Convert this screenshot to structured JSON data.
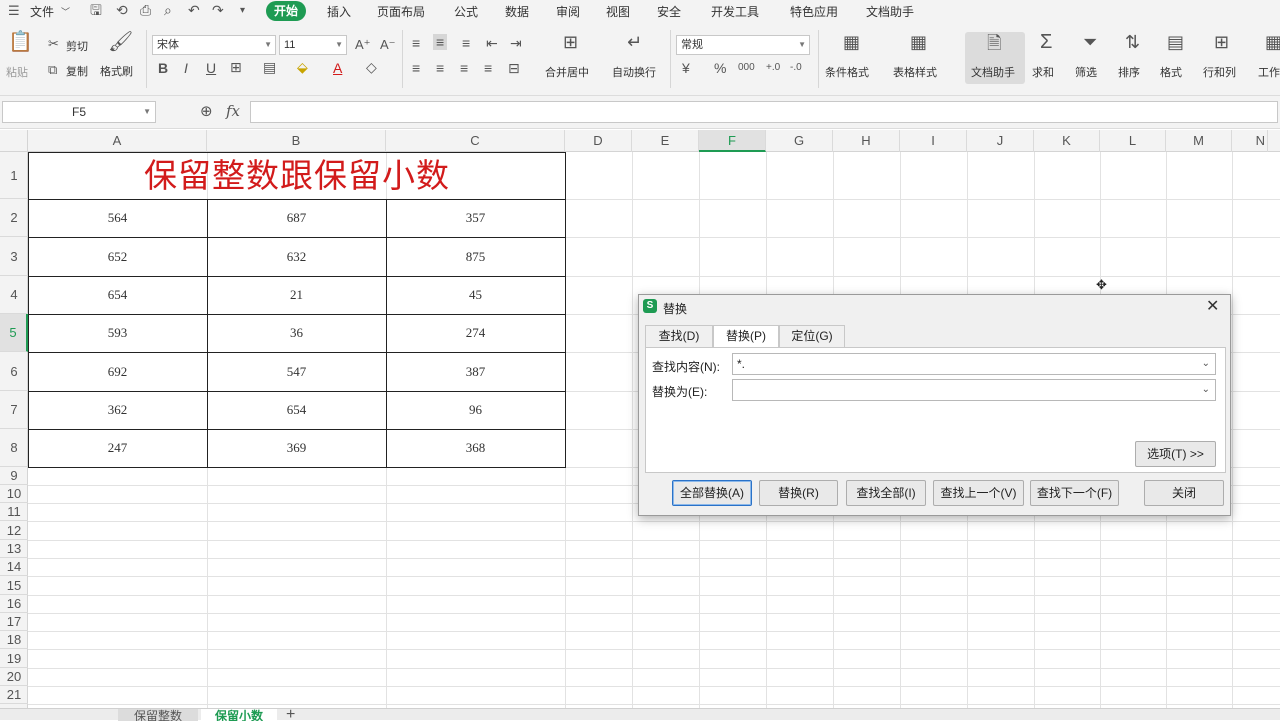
{
  "menubar": {
    "items": [
      "文件",
      "开始",
      "插入",
      "页面布局",
      "公式",
      "数据",
      "审阅",
      "视图",
      "安全",
      "开发工具",
      "特色应用",
      "文档助手"
    ],
    "active": "开始",
    "active_color": "#1e9b53"
  },
  "ribbon": {
    "paste": "粘贴",
    "cut": "剪切",
    "copy": "复制",
    "format_painter": "格式刷",
    "font_name": "宋体",
    "font_size": "11",
    "bold": "B",
    "italic": "I",
    "underline": "U",
    "font_color": "A",
    "merge_center": "合并居中",
    "wrap_text": "自动换行",
    "number_format": "常规",
    "percent": "%",
    "thousands": "000",
    "cond_format": "条件格式",
    "table_style": "表格样式",
    "doc_assistant": "文档助手",
    "sum": "求和",
    "filter": "筛选",
    "sort": "排序",
    "format": "格式",
    "row_col": "行和列",
    "worksheet": "工作"
  },
  "formula_bar": {
    "name_box": "F5",
    "fx": "fx",
    "content": ""
  },
  "columns": [
    "A",
    "B",
    "C",
    "D",
    "E",
    "F",
    "G",
    "H",
    "I",
    "J",
    "K",
    "L",
    "M",
    "N"
  ],
  "rows": [
    "1",
    "2",
    "3",
    "4",
    "5",
    "6",
    "7",
    "8",
    "9",
    "10",
    "11",
    "12",
    "13",
    "14",
    "15",
    "16",
    "17",
    "18",
    "19",
    "20",
    "21"
  ],
  "sheet": {
    "title": "保留整数跟保留小数",
    "title_color": "#d21b1b",
    "data": [
      [
        "564",
        "687",
        "357"
      ],
      [
        "652",
        "632",
        "875"
      ],
      [
        "654",
        "21",
        "45"
      ],
      [
        "593",
        "36",
        "274"
      ],
      [
        "692",
        "547",
        "387"
      ],
      [
        "362",
        "654",
        "96"
      ],
      [
        "247",
        "369",
        "368"
      ]
    ]
  },
  "sheet_tabs": [
    "保留整数",
    "保留小数"
  ],
  "active_sheet_tab": "保留小数",
  "dialog": {
    "title": "替换",
    "tabs": [
      "查找(D)",
      "替换(P)",
      "定位(G)"
    ],
    "active_tab": "替换(P)",
    "find_label": "查找内容(N):",
    "find_value": "*.",
    "replace_label": "替换为(E):",
    "replace_value": "",
    "options_button": "选项(T) >>",
    "buttons": [
      "全部替换(A)",
      "替换(R)",
      "查找全部(I)",
      "查找上一个(V)",
      "查找下一个(F)",
      "关闭"
    ]
  }
}
